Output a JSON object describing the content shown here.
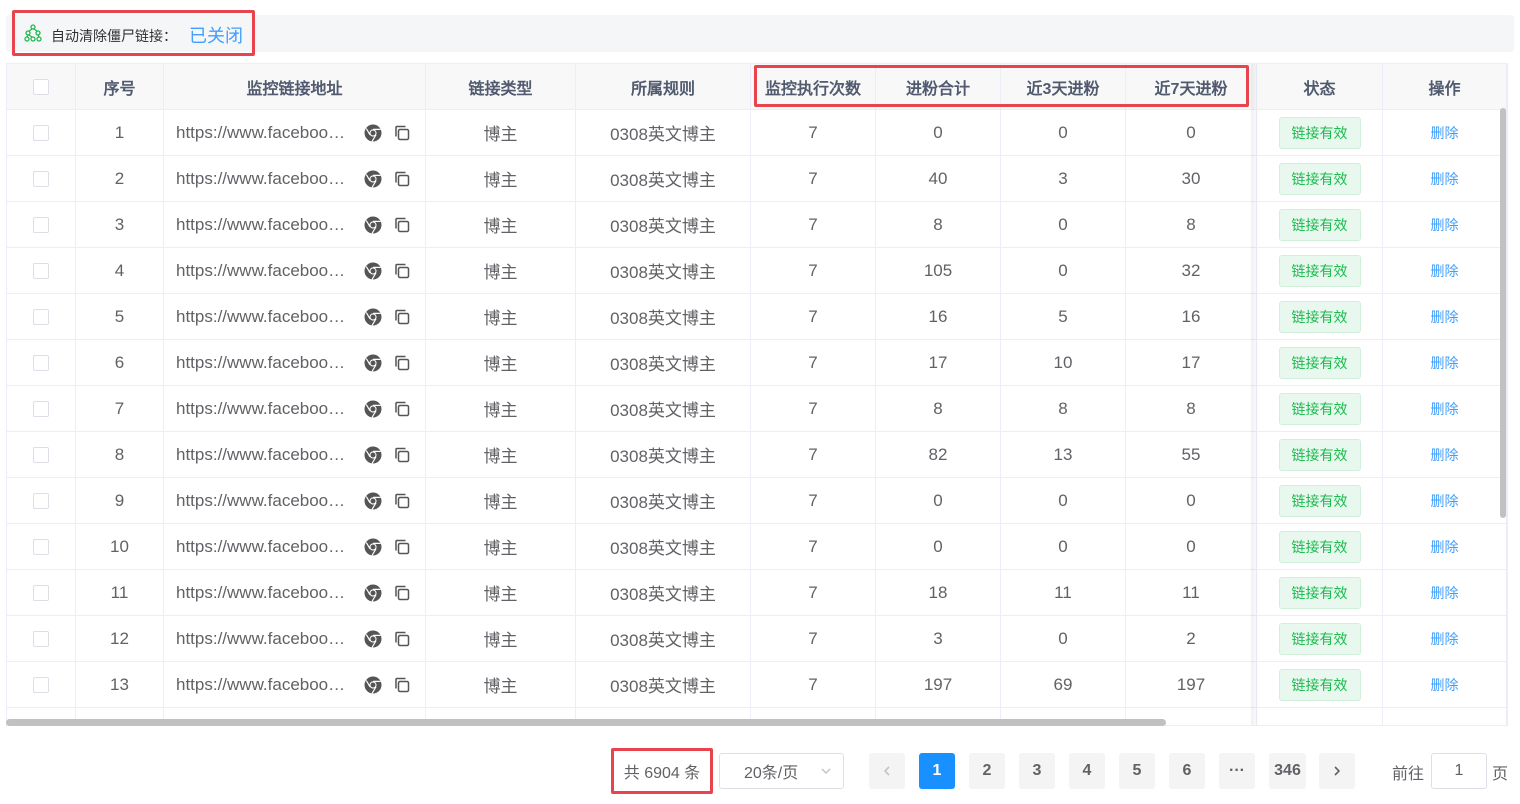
{
  "topbar": {
    "label": "自动清除僵尸链接：",
    "value": "已关闭"
  },
  "columns": [
    "",
    "序号",
    "监控链接地址",
    "链接类型",
    "所属规则",
    "监控执行次数",
    "进粉合计",
    "近3天进粉",
    "近7天进粉",
    "状态",
    "操作"
  ],
  "rows": [
    {
      "idx": "1",
      "url": "https://www.facebook.com/",
      "type": "博主",
      "rule": "0308英文博主",
      "runs": "7",
      "total": "0",
      "d3": "0",
      "d7": "0",
      "status": "链接有效",
      "action": "删除"
    },
    {
      "idx": "2",
      "url": "https://www.facebook.com/",
      "type": "博主",
      "rule": "0308英文博主",
      "runs": "7",
      "total": "40",
      "d3": "3",
      "d7": "30",
      "status": "链接有效",
      "action": "删除"
    },
    {
      "idx": "3",
      "url": "https://www.facebook.com/",
      "type": "博主",
      "rule": "0308英文博主",
      "runs": "7",
      "total": "8",
      "d3": "0",
      "d7": "8",
      "status": "链接有效",
      "action": "删除"
    },
    {
      "idx": "4",
      "url": "https://www.facebook.com/",
      "type": "博主",
      "rule": "0308英文博主",
      "runs": "7",
      "total": "105",
      "d3": "0",
      "d7": "32",
      "status": "链接有效",
      "action": "删除"
    },
    {
      "idx": "5",
      "url": "https://www.facebook.com/",
      "type": "博主",
      "rule": "0308英文博主",
      "runs": "7",
      "total": "16",
      "d3": "5",
      "d7": "16",
      "status": "链接有效",
      "action": "删除"
    },
    {
      "idx": "6",
      "url": "https://www.facebook.com/",
      "type": "博主",
      "rule": "0308英文博主",
      "runs": "7",
      "total": "17",
      "d3": "10",
      "d7": "17",
      "status": "链接有效",
      "action": "删除"
    },
    {
      "idx": "7",
      "url": "https://www.facebook.com/",
      "type": "博主",
      "rule": "0308英文博主",
      "runs": "7",
      "total": "8",
      "d3": "8",
      "d7": "8",
      "status": "链接有效",
      "action": "删除"
    },
    {
      "idx": "8",
      "url": "https://www.facebook.com/",
      "type": "博主",
      "rule": "0308英文博主",
      "runs": "7",
      "total": "82",
      "d3": "13",
      "d7": "55",
      "status": "链接有效",
      "action": "删除"
    },
    {
      "idx": "9",
      "url": "https://www.facebook.com/",
      "type": "博主",
      "rule": "0308英文博主",
      "runs": "7",
      "total": "0",
      "d3": "0",
      "d7": "0",
      "status": "链接有效",
      "action": "删除"
    },
    {
      "idx": "10",
      "url": "https://www.facebook.com/",
      "type": "博主",
      "rule": "0308英文博主",
      "runs": "7",
      "total": "0",
      "d3": "0",
      "d7": "0",
      "status": "链接有效",
      "action": "删除"
    },
    {
      "idx": "11",
      "url": "https://www.facebook.com/",
      "type": "博主",
      "rule": "0308英文博主",
      "runs": "7",
      "total": "18",
      "d3": "11",
      "d7": "11",
      "status": "链接有效",
      "action": "删除"
    },
    {
      "idx": "12",
      "url": "https://www.facebook.com/",
      "type": "博主",
      "rule": "0308英文博主",
      "runs": "7",
      "total": "3",
      "d3": "0",
      "d7": "2",
      "status": "链接有效",
      "action": "删除"
    },
    {
      "idx": "13",
      "url": "https://www.facebook.com/",
      "type": "博主",
      "rule": "0308英文博主",
      "runs": "7",
      "total": "197",
      "d3": "69",
      "d7": "197",
      "status": "链接有效",
      "action": "删除"
    }
  ],
  "pagination": {
    "total": "共 6904 条",
    "page_size": "20条/页",
    "pages": [
      "1",
      "2",
      "3",
      "4",
      "5",
      "6",
      "···",
      "346"
    ],
    "active": "1",
    "goto_label": "前往",
    "goto_value": "1",
    "page_unit": "页"
  },
  "colors": {
    "accent": "#409eff",
    "active_page": "#1890ff",
    "tag_text": "#1cbb4e",
    "tag_bg": "#e8f8ee",
    "highlight": "#e9444d"
  },
  "icons": {
    "topbar": "tree-icon",
    "chrome": "chrome-icon",
    "copy": "copy-icon",
    "prev": "chevron-left-icon",
    "next": "chevron-right-icon",
    "select": "chevron-down-icon"
  }
}
